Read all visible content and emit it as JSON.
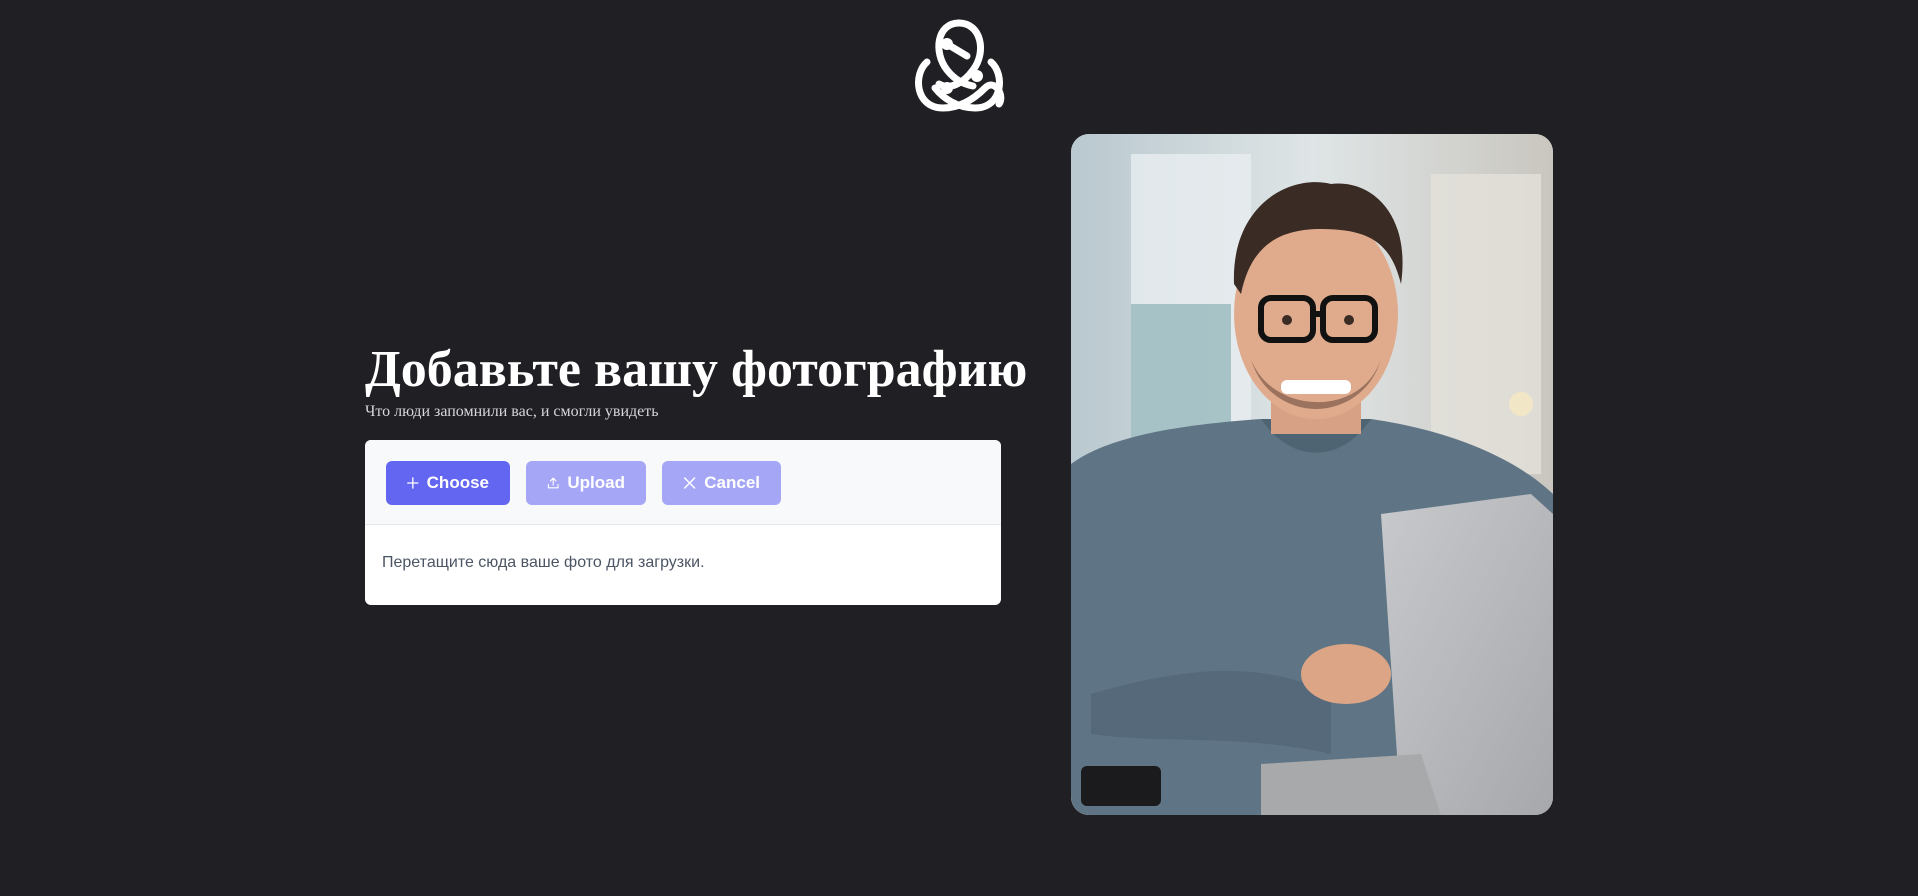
{
  "brand": {
    "logo_icon": "knot-logo-icon"
  },
  "main": {
    "title": "Добавьте вашу фотографию",
    "subtitle": "Что люди запомнили вас, и смогли увидеть"
  },
  "uploader": {
    "choose_label": "Choose",
    "upload_label": "Upload",
    "cancel_label": "Cancel",
    "dropzone_text": "Перетащите сюда ваше фото для загрузки.",
    "icons": {
      "choose": "plus-icon",
      "upload": "upload-icon",
      "cancel": "close-icon"
    }
  },
  "colors": {
    "background": "#1f1f24",
    "accent": "#6366f1",
    "accent_disabled": "#a5a6f6"
  },
  "photo": {
    "subject": "smiling-man-with-glasses-at-laptop"
  }
}
